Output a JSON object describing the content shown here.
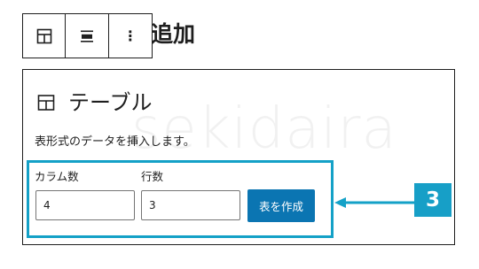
{
  "heading": {
    "fragment": "追加"
  },
  "toolbar": {
    "buttons": [
      {
        "icon": "table-icon"
      },
      {
        "icon": "align-icon"
      },
      {
        "icon": "more-options-icon",
        "glyph": "⋮"
      }
    ]
  },
  "block": {
    "icon": "table-icon",
    "title": "テーブル",
    "description": "表形式のデータを挿入します。",
    "watermark": "sekidaira",
    "columns": {
      "label": "カラム数",
      "value": "4"
    },
    "rows": {
      "label": "行数",
      "value": "3"
    },
    "create_button": "表を作成"
  },
  "annotation": {
    "badge": "3",
    "color": "#14a1c7"
  },
  "colors": {
    "primary_button": "#0b75b2",
    "highlight": "#14a1c7",
    "text": "#1e1e1e"
  }
}
